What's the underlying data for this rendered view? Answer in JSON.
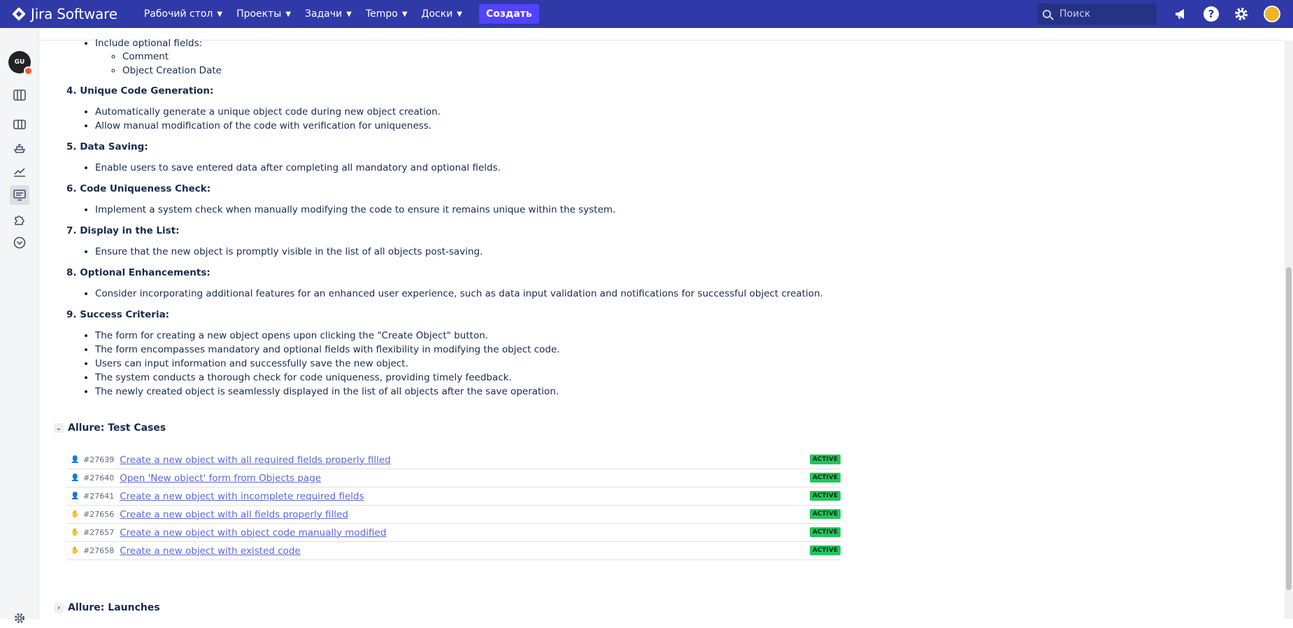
{
  "topbar": {
    "app_name": "Jira Software",
    "nav": [
      {
        "label": "Рабочий стол"
      },
      {
        "label": "Проекты"
      },
      {
        "label": "Задачи"
      },
      {
        "label": "Tempo"
      },
      {
        "label": "Доски"
      }
    ],
    "create_label": "Создать",
    "search_placeholder": "Поиск",
    "icons": [
      "megaphone-icon",
      "help-icon",
      "gear-icon",
      "user-avatar"
    ],
    "colors": {
      "bar": "#2f3aa8",
      "create": "#5243ff"
    }
  },
  "sidebar": {
    "project_avatar_text": "GU",
    "icons": [
      "board-icon",
      "columns-icon",
      "ship-icon",
      "chart-icon",
      "monitor-icon",
      "puzzle-icon",
      "chevron-circle-icon",
      "settings-icon"
    ]
  },
  "description": {
    "partial_item": "Include optional fields:",
    "optional_fields": [
      "Comment",
      "Object Creation Date"
    ],
    "sections": [
      {
        "heading": "4. Unique Code Generation:",
        "items": [
          "Automatically generate a unique object code during new object creation.",
          "Allow manual modification of the code with verification for uniqueness."
        ]
      },
      {
        "heading": "5. Data Saving:",
        "items": [
          "Enable users to save entered data after completing all mandatory and optional fields."
        ]
      },
      {
        "heading": "6. Code Uniqueness Check:",
        "items": [
          "Implement a system check when manually modifying the code to ensure it remains unique within the system."
        ]
      },
      {
        "heading": "7. Display in the List:",
        "items": [
          "Ensure that the new object is promptly visible in the list of all objects post-saving."
        ]
      },
      {
        "heading": "8. Optional Enhancements:",
        "items": [
          "Consider incorporating additional features for an enhanced user experience, such as data input validation and notifications for successful object creation."
        ]
      },
      {
        "heading": "9. Success Criteria:",
        "items": [
          "The form for creating a new object opens upon clicking the \"Create Object\" button.",
          "The form encompasses mandatory and optional fields with flexibility in modifying the object code.",
          "Users can input information and successfully save the new object.",
          "The system conducts a thorough check for code uniqueness, providing timely feedback.",
          "The newly created object is seamlessly displayed in the list of all objects after the save operation."
        ]
      }
    ]
  },
  "allure_test_cases": {
    "title": "Allure: Test Cases",
    "rows": [
      {
        "icon": "user-icon",
        "id": "#27639",
        "title": "Create a new object with all required fields properly filled",
        "status": "ACTIVE"
      },
      {
        "icon": "user-icon",
        "id": "#27640",
        "title": "Open 'New object' form from Objects page",
        "status": "ACTIVE"
      },
      {
        "icon": "user-icon",
        "id": "#27641",
        "title": "Create a new object with incomplete required fields",
        "status": "ACTIVE"
      },
      {
        "icon": "hand-icon",
        "id": "#27656",
        "title": "Create a new object with all fields properly filled",
        "status": "ACTIVE"
      },
      {
        "icon": "hand-icon",
        "id": "#27657",
        "title": "Create a new object with object code manually modified",
        "status": "ACTIVE"
      },
      {
        "icon": "hand-icon",
        "id": "#27658",
        "title": "Create a new object with existed code",
        "status": "ACTIVE"
      }
    ]
  },
  "allure_launches": {
    "title": "Allure: Launches"
  }
}
